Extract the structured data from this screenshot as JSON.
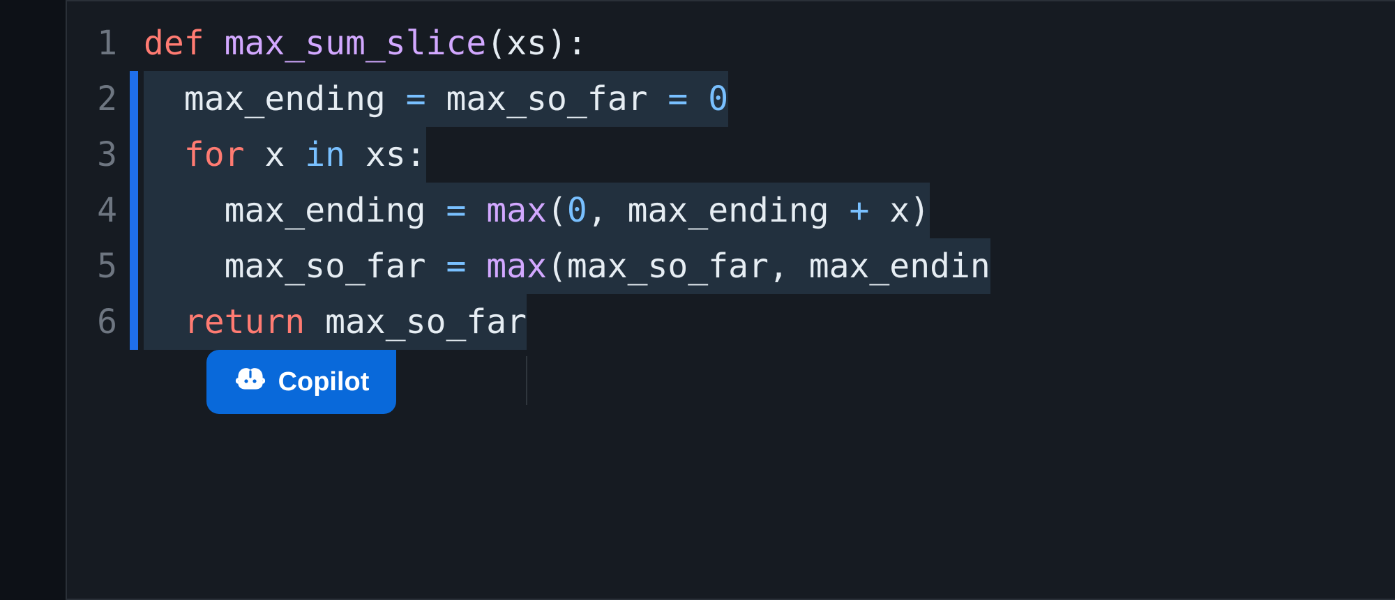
{
  "editor": {
    "lines": [
      {
        "num": "1",
        "marker": false,
        "highlight": false
      },
      {
        "num": "2",
        "marker": true,
        "highlight": true
      },
      {
        "num": "3",
        "marker": true,
        "highlight": true
      },
      {
        "num": "4",
        "marker": true,
        "highlight": true
      },
      {
        "num": "5",
        "marker": true,
        "highlight": true
      },
      {
        "num": "6",
        "marker": true,
        "highlight": true
      }
    ],
    "code": {
      "l1": {
        "def": "def",
        "sp1": " ",
        "fn": "max_sum_slice",
        "op": "(",
        "arg": "xs",
        "cp": ")",
        "colon": ":"
      },
      "l2": {
        "indent": "  ",
        "id1": "max_ending",
        "sp1": " ",
        "eq1": "=",
        "sp2": " ",
        "id2": "max_so_far",
        "sp3": " ",
        "eq2": "=",
        "sp4": " ",
        "zero": "0"
      },
      "l3": {
        "indent": "  ",
        "for": "for",
        "sp1": " ",
        "x": "x",
        "sp2": " ",
        "in": "in",
        "sp3": " ",
        "xs": "xs",
        "colon": ":"
      },
      "l4": {
        "indent": "    ",
        "id1": "max_ending",
        "sp1": " ",
        "eq": "=",
        "sp2": " ",
        "call": "max",
        "op": "(",
        "zero": "0",
        "comma": ",",
        "sp3": " ",
        "id2": "max_ending",
        "sp4": " ",
        "plus": "+",
        "sp5": " ",
        "x": "x",
        "cp": ")"
      },
      "l5": {
        "indent": "    ",
        "id1": "max_so_far",
        "sp1": " ",
        "eq": "=",
        "sp2": " ",
        "call": "max",
        "op": "(",
        "id2": "max_so_far",
        "comma": ",",
        "sp3": " ",
        "id3": "max_endin"
      },
      "l6": {
        "indent": "  ",
        "ret": "return",
        "sp1": " ",
        "id": "max_so_far"
      }
    }
  },
  "copilot": {
    "label": "Copilot"
  }
}
